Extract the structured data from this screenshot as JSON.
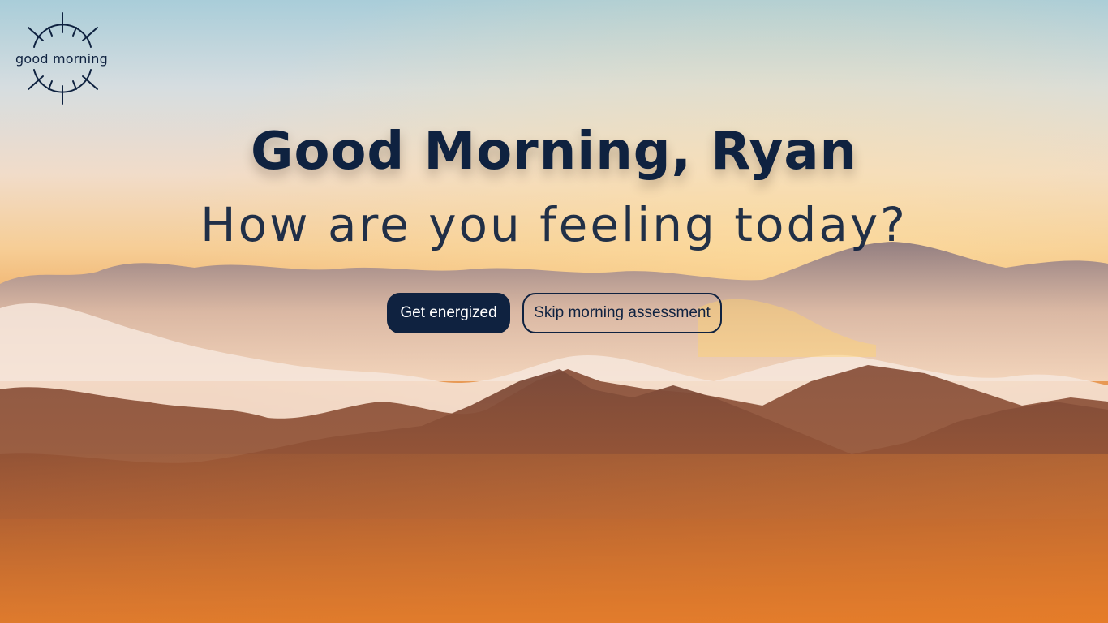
{
  "background": {
    "description_icon": "mountain-sunrise-clouds-image"
  },
  "logo": {
    "text": "good morning",
    "icon": "sun-icon"
  },
  "greeting": {
    "title": "Good Morning, Ryan",
    "subtitle": "How are you feeling today?"
  },
  "actions": {
    "primary_label": "Get energized",
    "secondary_label": "Skip morning assessment"
  },
  "colors": {
    "navy": "#0f2240",
    "white": "#ffffff",
    "sunset_orange": "#e58a43"
  }
}
